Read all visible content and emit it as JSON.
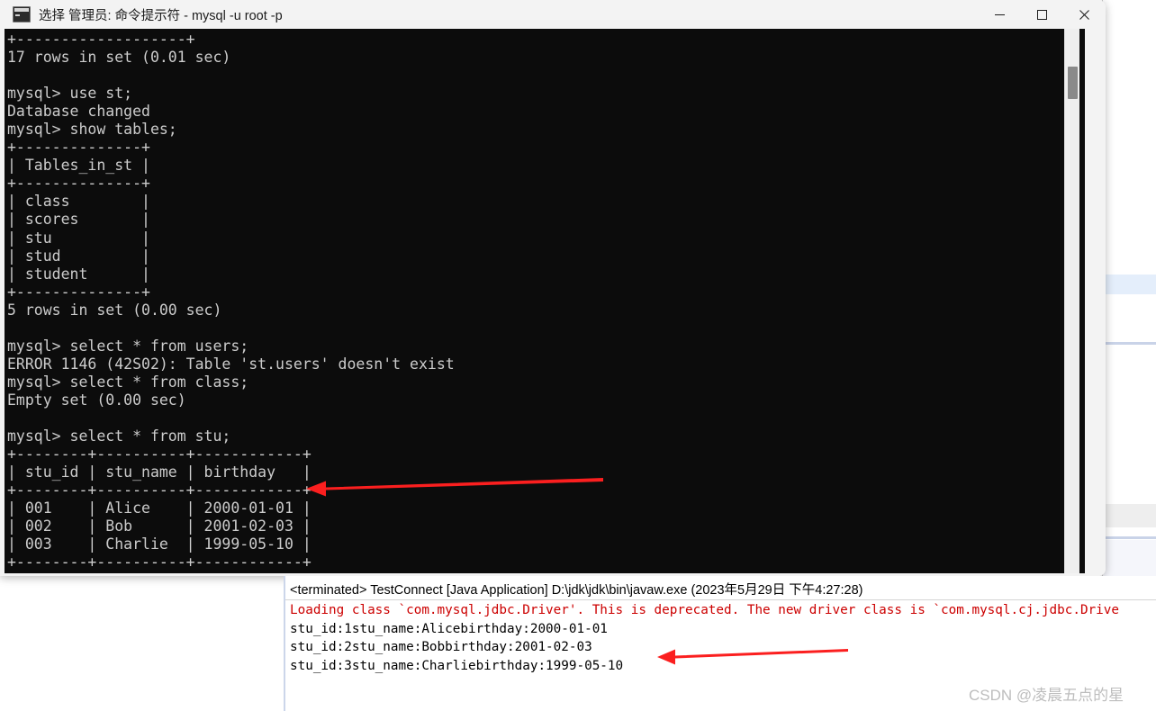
{
  "window": {
    "title": "选择 管理员: 命令提示符 - mysql  -u root -p",
    "icon": "console-icon",
    "controls": {
      "minimize": "Minimize",
      "maximize": "Maximize",
      "close": "Close"
    }
  },
  "terminal": {
    "prompt": "mysql>",
    "lines": [
      "+-------------------+",
      "17 rows in set (0.01 sec)",
      "",
      "mysql> use st;",
      "Database changed",
      "mysql> show tables;",
      "+--------------+",
      "| Tables_in_st |",
      "+--------------+",
      "| class        |",
      "| scores       |",
      "| stu          |",
      "| stud         |",
      "| student      |",
      "+--------------+",
      "5 rows in set (0.00 sec)",
      "",
      "mysql> select * from users;",
      "ERROR 1146 (42S02): Table 'st.users' doesn't exist",
      "mysql> select * from class;",
      "Empty set (0.00 sec)",
      "",
      "mysql> select * from stu;",
      "+--------+----------+------------+",
      "| stu_id | stu_name | birthday   |",
      "+--------+----------+------------+",
      "| 001    | Alice    | 2000-01-01 |",
      "| 002    | Bob      | 2001-02-03 |",
      "| 003    | Charlie  | 1999-05-10 |",
      "+--------+----------+------------+"
    ],
    "queries": [
      "use st;",
      "show tables;",
      "select * from users;",
      "select * from class;",
      "select * from stu;"
    ],
    "tables_in_st": [
      "class",
      "scores",
      "stu",
      "stud",
      "student"
    ],
    "stu_table": {
      "columns": [
        "stu_id",
        "stu_name",
        "birthday"
      ],
      "rows": [
        [
          "001",
          "Alice",
          "2000-01-01"
        ],
        [
          "002",
          "Bob",
          "2001-02-03"
        ],
        [
          "003",
          "Charlie",
          "1999-05-10"
        ]
      ]
    },
    "messages": [
      "17 rows in set (0.01 sec)",
      "Database changed",
      "5 rows in set (0.00 sec)",
      "ERROR 1146 (42S02): Table 'st.users' doesn't exist",
      "Empty set (0.00 sec)"
    ],
    "colors": {
      "background": "#0c0c0c",
      "foreground": "#cccccc"
    }
  },
  "eclipse_console": {
    "header": "<terminated> TestConnect [Java Application] D:\\jdk\\jdk\\bin\\javaw.exe (2023年5月29日 下午4:27:28)",
    "warning_line": "Loading class `com.mysql.jdbc.Driver'. This is deprecated. The new driver class is `com.mysql.cj.jdbc.Drive",
    "output_lines": [
      "stu_id:1stu_name:Alicebirthday:2000-01-01",
      "stu_id:2stu_name:Bobbirthday:2001-02-03",
      "stu_id:3stu_name:Charliebirthday:1999-05-10"
    ],
    "colors": {
      "error": "#cc0000",
      "text": "#000000"
    }
  },
  "annotations": {
    "arrow_color": "#fb1f1f",
    "arrow_table_label": "points-to-stu-table-result",
    "arrow_console_label": "points-to-console-row-3"
  },
  "watermark": {
    "text": "CSDN @凌晨五点的星"
  }
}
